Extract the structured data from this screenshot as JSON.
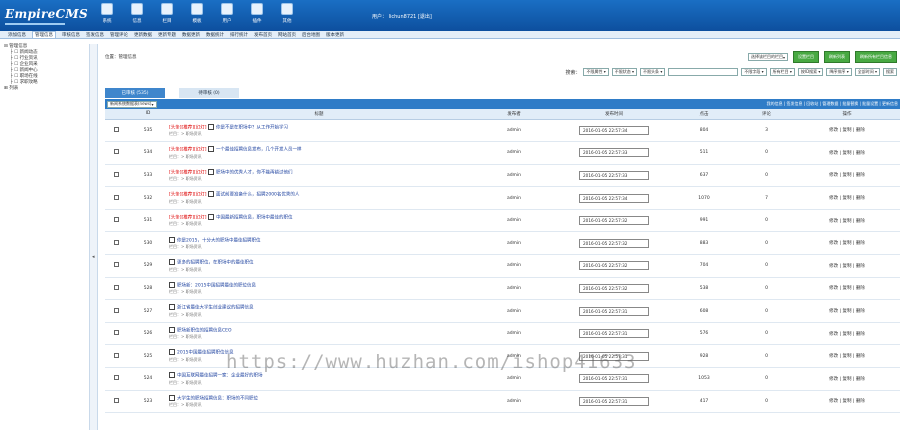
{
  "header": {
    "logo_main": "EmpireCMS",
    "icons": [
      {
        "label": "系统",
        "icon": "system-icon"
      },
      {
        "label": "信息",
        "icon": "info-icon"
      },
      {
        "label": "栏目",
        "icon": "column-icon"
      },
      {
        "label": "模板",
        "icon": "template-icon"
      },
      {
        "label": "用户",
        "icon": "user-icon"
      },
      {
        "label": "插件",
        "icon": "plugin-icon"
      },
      {
        "label": "其他",
        "icon": "other-icon"
      }
    ],
    "user_label": "用户：",
    "username": "lichun8721",
    "logout": "[退出]"
  },
  "nav": {
    "items": [
      "添加信息",
      "管理信息",
      "审核信息",
      "签发信息",
      "管理评论",
      "更新数据",
      "更新专题",
      "数据更新",
      "数据统计",
      "排行统计",
      "发布首页",
      "网站首页",
      "后台地图",
      "版本更新"
    ],
    "active": 1
  },
  "sidebar": {
    "title": "管理信息",
    "items": [
      "新闻动态",
      "行业资讯",
      "企业风采",
      "新闻中心",
      "职场在线",
      "求职攻略",
      "列表"
    ]
  },
  "main": {
    "position": "位置：管理信息",
    "column_select": "选择该栏目的栏目",
    "buttons": [
      "设置栏目",
      "刷新列表",
      "刷新所有栏目信息"
    ],
    "filter": {
      "label": "搜索：",
      "selects": [
        "不限属性",
        "不限状态",
        "不限头条",
        "不限字段",
        "所有栏目",
        "按ID搜索",
        "降序排序",
        "全部时间"
      ],
      "search_btn": "搜索"
    },
    "tabs": [
      {
        "label": "已审核 (535)"
      },
      {
        "label": "待审核 (0)"
      }
    ],
    "table_select": "新闻系统数据表(news)",
    "bar_links": "我的信息 | 签发信息 | 回收站 | 管理数据 | 批量替换 | 批量设置 | 更新信息",
    "columns": [
      "ID",
      "标题",
      "发布者",
      "发布时间",
      "点击",
      "评论",
      "操作"
    ],
    "rows": [
      {
        "id": "535",
        "tag": "[头条][推荐][幻灯]",
        "title": "你是不是在职场中？从工作开始学习",
        "sub": "栏目：> 职场资讯",
        "author": "admin",
        "time": "2016-01-05 22:57:34",
        "clicks": "804",
        "comments": "3"
      },
      {
        "id": "534",
        "tag": "[头条][推荐][幻灯]",
        "title": "一个最佳招聘信息发布，几个开发人员一样",
        "sub": "栏目：> 职场资讯",
        "author": "admin",
        "time": "2016-01-05 22:57:33",
        "clicks": "511",
        "comments": "0"
      },
      {
        "id": "533",
        "tag": "[头条][推荐][幻灯]",
        "title": "职场中的优秀人才，你不能再错过他们",
        "sub": "栏目：> 职场资讯",
        "author": "admin",
        "time": "2016-01-05 22:57:33",
        "clicks": "637",
        "comments": "0"
      },
      {
        "id": "532",
        "tag": "[头条][推荐][幻灯]",
        "title": "面试前要准备什么，招聘2000名优秀的人",
        "sub": "栏目：> 职场资讯",
        "author": "admin",
        "time": "2016-01-05 22:57:34",
        "clicks": "1070",
        "comments": "7"
      },
      {
        "id": "531",
        "tag": "[头条][推荐][幻灯]",
        "title": "中国最新招聘信息，职场中最佳的职位",
        "sub": "栏目：> 职场资讯",
        "author": "admin",
        "time": "2016-01-05 22:57:32",
        "clicks": "991",
        "comments": "0"
      },
      {
        "id": "530",
        "tag": "",
        "title": "你是2015，十分大的职场中最佳招聘职位",
        "sub": "栏目：> 职场资讯",
        "author": "admin",
        "time": "2016-01-05 22:57:32",
        "clicks": "883",
        "comments": "0"
      },
      {
        "id": "529",
        "tag": "",
        "title": "更多的招聘职位，在职场中的最佳职位",
        "sub": "栏目：> 职场资讯",
        "author": "admin",
        "time": "2016-01-05 22:57:32",
        "clicks": "704",
        "comments": "0"
      },
      {
        "id": "528",
        "tag": "",
        "title": "职场新：2015中国招聘最佳的职位信息",
        "sub": "栏目：> 职场资讯",
        "author": "admin",
        "time": "2016-01-05 22:57:32",
        "clicks": "538",
        "comments": "0"
      },
      {
        "id": "527",
        "tag": "",
        "title": "浙江省最佳大学生创业建议的招聘信息",
        "sub": "栏目：> 职场资讯",
        "author": "admin",
        "time": "2016-01-05 22:57:31",
        "clicks": "608",
        "comments": "0"
      },
      {
        "id": "526",
        "tag": "",
        "title": "职场新职位的招聘信息CEO",
        "sub": "栏目：> 职场资讯",
        "author": "admin",
        "time": "2016-01-05 22:57:31",
        "clicks": "576",
        "comments": "0"
      },
      {
        "id": "525",
        "tag": "",
        "title": "2015中国最佳招聘职位信息",
        "sub": "栏目：> 职场资讯",
        "author": "admin",
        "time": "2016-01-05 22:57:31",
        "clicks": "928",
        "comments": "0"
      },
      {
        "id": "524",
        "tag": "",
        "title": "中国互联网最佳招聘一家：企业最好的职场",
        "sub": "栏目：> 职场资讯",
        "author": "admin",
        "time": "2016-01-05 22:57:31",
        "clicks": "1053",
        "comments": "0"
      },
      {
        "id": "523",
        "tag": "",
        "title": "大学生的职场招聘信息：职场的不同职位",
        "sub": "栏目：> 职场资讯",
        "author": "admin",
        "time": "2016-01-05 22:57:31",
        "clicks": "417",
        "comments": "0"
      }
    ],
    "ops": {
      "edit": "修改",
      "sep": " | ",
      "copy": "复制",
      "del": "删除"
    }
  },
  "watermark": "https://www.huzhan.com/ishop41633"
}
